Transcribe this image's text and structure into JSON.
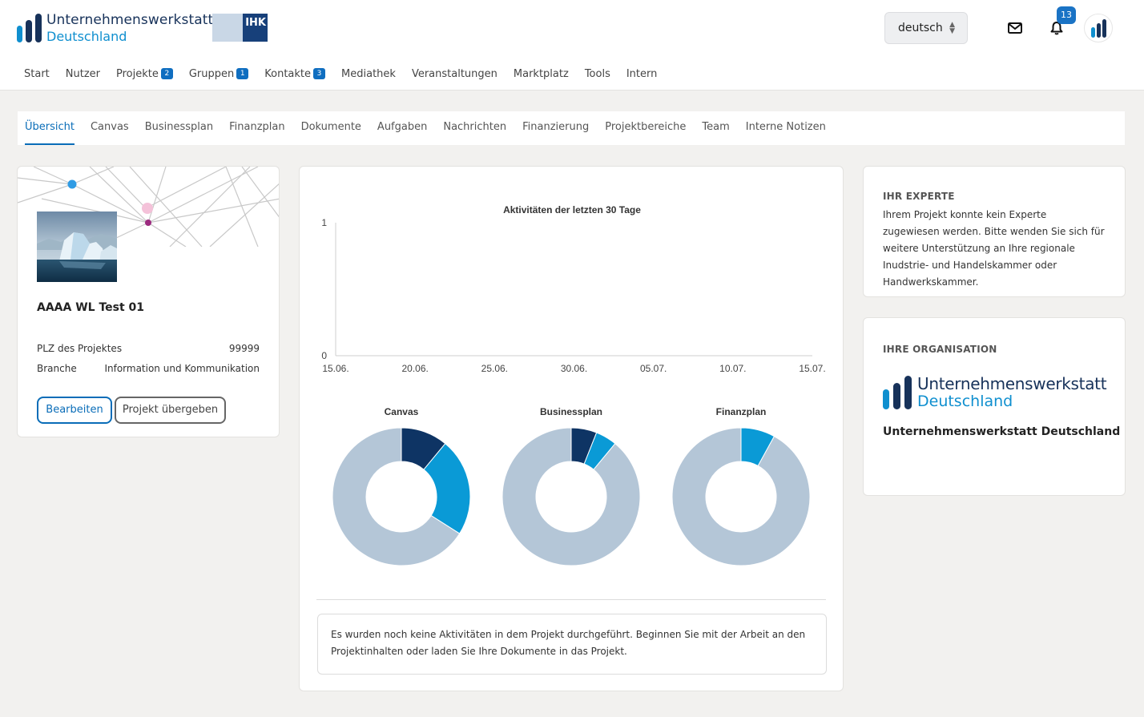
{
  "header": {
    "logo_line1": "Unternehmenswerkstatt",
    "logo_line2": "Deutschland",
    "partner_logo": "IHK",
    "language": "deutsch",
    "notifications_count": "13",
    "icons": [
      "mail-icon",
      "bell-icon",
      "user-avatar-icon"
    ]
  },
  "nav": {
    "items": [
      {
        "label": "Start"
      },
      {
        "label": "Nutzer"
      },
      {
        "label": "Projekte",
        "badge": "2"
      },
      {
        "label": "Gruppen",
        "badge": "1"
      },
      {
        "label": "Kontakte",
        "badge": "3"
      },
      {
        "label": "Mediathek"
      },
      {
        "label": "Veranstaltungen"
      },
      {
        "label": "Marktplatz"
      },
      {
        "label": "Tools"
      },
      {
        "label": "Intern"
      }
    ]
  },
  "subnav": {
    "tabs": [
      "Übersicht",
      "Canvas",
      "Businessplan",
      "Finanzplan",
      "Dokumente",
      "Aufgaben",
      "Nachrichten",
      "Finanzierung",
      "Projektbereiche",
      "Team",
      "Interne Notizen"
    ],
    "active": "Übersicht"
  },
  "project": {
    "title": "AAAA WL Test 01",
    "plz_label": "PLZ des Projektes",
    "plz_value": "99999",
    "branche_label": "Branche",
    "branche_value": "Information und Kommunikation",
    "edit_button": "Bearbeiten",
    "transfer_button": "Projekt übergeben"
  },
  "activity": {
    "info_text": "Es wurden noch keine Aktivitäten in dem Projekt durchgeführt. Beginnen Sie mit der Arbeit an den Projektinhalten oder laden Sie Ihre Dokumente in das Projekt."
  },
  "chart_data": [
    {
      "type": "line",
      "title": "Aktivitäten der letzten 30 Tage",
      "x": [
        "15.06.",
        "20.06.",
        "25.06.",
        "30.06.",
        "05.07.",
        "10.07.",
        "15.07."
      ],
      "series": [
        {
          "values": [
            0,
            0,
            0,
            0,
            0,
            0,
            0
          ]
        }
      ],
      "ylim": [
        0,
        1
      ],
      "yticks": [
        "0",
        "1"
      ],
      "grid": false
    },
    {
      "type": "pie",
      "title": "Canvas",
      "slices": [
        {
          "value": 11,
          "color": "#0e3464"
        },
        {
          "value": 23,
          "color": "#0a9ad6"
        },
        {
          "value": 66,
          "color": "#b4c6d7"
        }
      ]
    },
    {
      "type": "pie",
      "title": "Businessplan",
      "slices": [
        {
          "value": 6,
          "color": "#0e3464"
        },
        {
          "value": 5,
          "color": "#0a9ad6"
        },
        {
          "value": 89,
          "color": "#b4c6d7"
        }
      ]
    },
    {
      "type": "pie",
      "title": "Finanzplan",
      "slices": [
        {
          "value": 8,
          "color": "#0a9ad6"
        },
        {
          "value": 92,
          "color": "#b4c6d7"
        }
      ]
    }
  ],
  "expert": {
    "heading": "IHR EXPERTE",
    "text": "Ihrem Projekt konnte kein Experte zugewiesen werden. Bitte wenden Sie sich für weitere Unterstützung an Ihre regionale Inudstrie- und Handelskammer oder Handwerkskammer."
  },
  "organisation": {
    "heading": "IHRE ORGANISATION",
    "logo_line1": "Unternehmenswerkstatt",
    "logo_line2": "Deutschland",
    "name": "Unternehmenswerkstatt Deutschland"
  }
}
